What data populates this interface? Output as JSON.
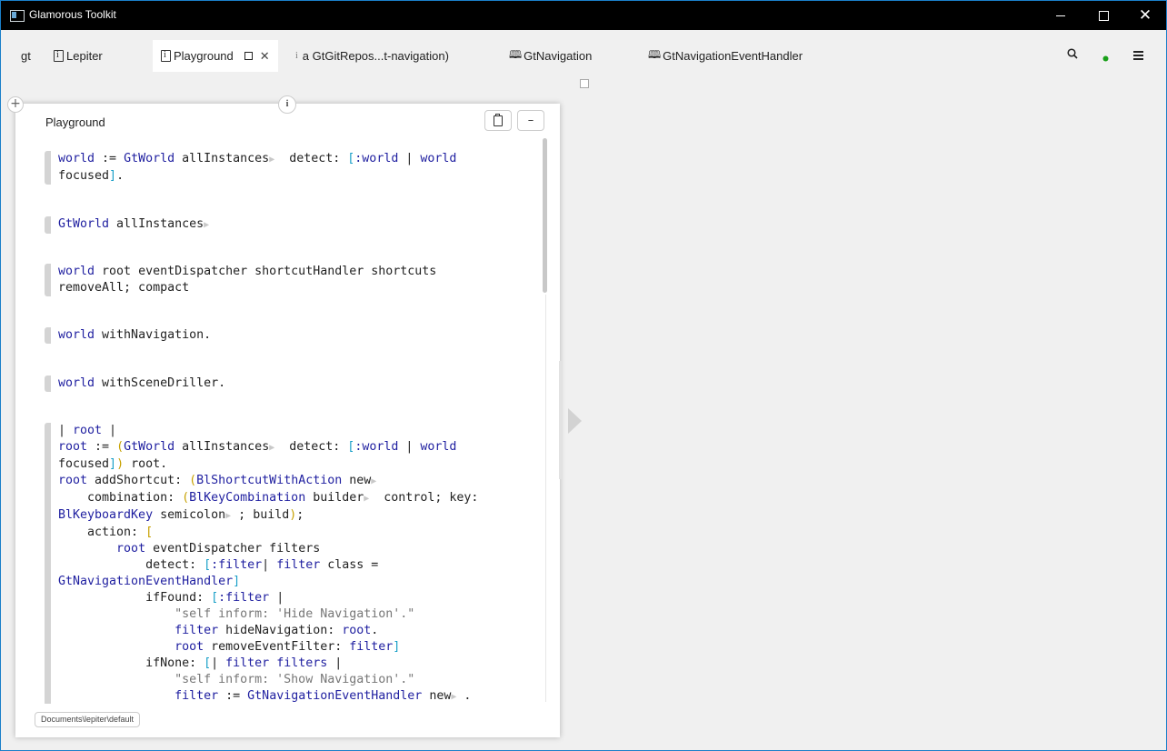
{
  "window": {
    "title": "Glamorous Toolkit"
  },
  "tabs": [
    {
      "label": "gt"
    },
    {
      "label": "Lepiter"
    },
    {
      "label": "Playground"
    },
    {
      "label": "a GtGitRepos...t-navigation)"
    },
    {
      "label": "GtNavigation"
    },
    {
      "label": "GtNavigationEventHandler"
    }
  ],
  "toolbar": {
    "status_color": "#1aa01a"
  },
  "playground": {
    "title": "Playground",
    "path": "Documents\\lepiter\\default"
  },
  "colors": {
    "keyword": "#1f1fa0",
    "paren": "#c7a100",
    "bracket": "#1aa0c8",
    "comment": "#777777",
    "accent": "#1a7fc9"
  }
}
